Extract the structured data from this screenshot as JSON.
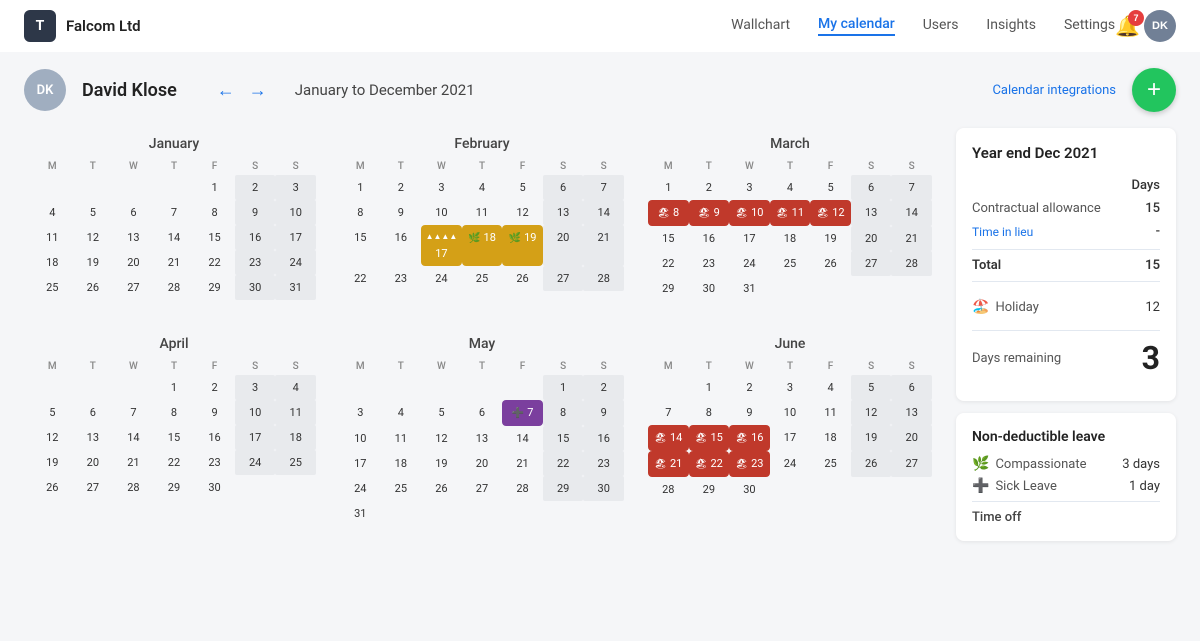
{
  "header": {
    "logo": "T",
    "company": "Falcom Ltd",
    "nav": [
      {
        "label": "Wallchart",
        "active": false
      },
      {
        "label": "My calendar",
        "active": true
      },
      {
        "label": "Users",
        "active": false
      },
      {
        "label": "Insights",
        "active": false
      },
      {
        "label": "Settings",
        "active": false
      }
    ],
    "notif_count": "7",
    "avatar": "DK"
  },
  "subheader": {
    "user_initials": "DK",
    "user_name": "David Klose",
    "date_range": "January to December 2021",
    "cal_integrations": "Calendar integrations",
    "add_btn": "+"
  },
  "calendars": [
    {
      "month": "January",
      "days_of_week": [
        "M",
        "T",
        "W",
        "T",
        "F",
        "S",
        "S"
      ],
      "weeks": [
        [
          null,
          null,
          null,
          null,
          1,
          2,
          3
        ],
        [
          4,
          5,
          6,
          7,
          8,
          9,
          10
        ],
        [
          11,
          12,
          13,
          14,
          15,
          16,
          17
        ],
        [
          18,
          19,
          20,
          21,
          22,
          23,
          24
        ],
        [
          25,
          26,
          27,
          28,
          29,
          30,
          31
        ]
      ],
      "special": {
        "2": "weekend",
        "3": "weekend",
        "9": "weekend",
        "10": "weekend",
        "16": "weekend",
        "17": "weekend",
        "23": "weekend",
        "24": "weekend",
        "30": "weekend",
        "31": "weekend"
      }
    },
    {
      "month": "February",
      "days_of_week": [
        "M",
        "T",
        "W",
        "T",
        "F",
        "S",
        "S"
      ],
      "weeks": [
        [
          1,
          2,
          3,
          4,
          5,
          6,
          7
        ],
        [
          8,
          9,
          10,
          11,
          12,
          13,
          14
        ],
        [
          15,
          16,
          17,
          18,
          19,
          20,
          21
        ],
        [
          22,
          23,
          24,
          25,
          26,
          27,
          28
        ]
      ],
      "special": {
        "6": "weekend",
        "7": "weekend",
        "13": "weekend",
        "14": "weekend",
        "17": "compassionate",
        "18": "compassionate",
        "19": "compassionate",
        "20": "weekend",
        "21": "weekend",
        "27": "weekend",
        "28": "weekend"
      }
    },
    {
      "month": "March",
      "days_of_week": [
        "M",
        "T",
        "W",
        "T",
        "F",
        "S",
        "S"
      ],
      "weeks": [
        [
          1,
          2,
          3,
          4,
          5,
          6,
          7
        ],
        [
          8,
          9,
          10,
          11,
          12,
          13,
          14
        ],
        [
          15,
          16,
          17,
          18,
          19,
          20,
          21
        ],
        [
          22,
          23,
          24,
          25,
          26,
          27,
          28
        ],
        [
          29,
          30,
          31,
          null,
          null,
          null,
          null
        ]
      ],
      "special": {
        "6": "weekend",
        "7": "weekend",
        "8": "holiday",
        "9": "holiday",
        "10": "holiday",
        "11": "holiday",
        "12": "holiday",
        "13": "weekend",
        "14": "weekend",
        "20": "weekend",
        "21": "weekend",
        "27": "weekend",
        "28": "weekend"
      }
    },
    {
      "month": "April",
      "days_of_week": [
        "M",
        "T",
        "W",
        "T",
        "F",
        "S",
        "S"
      ],
      "weeks": [
        [
          null,
          null,
          null,
          1,
          2,
          3,
          4
        ],
        [
          5,
          6,
          7,
          8,
          9,
          10,
          11
        ],
        [
          12,
          13,
          14,
          15,
          16,
          17,
          18
        ],
        [
          19,
          20,
          21,
          22,
          23,
          24,
          25
        ],
        [
          26,
          27,
          28,
          29,
          30,
          null,
          null
        ]
      ],
      "special": {
        "3": "weekend",
        "4": "weekend",
        "10": "weekend",
        "11": "weekend",
        "17": "weekend",
        "18": "weekend",
        "24": "weekend",
        "25": "weekend"
      }
    },
    {
      "month": "May",
      "days_of_week": [
        "M",
        "T",
        "W",
        "T",
        "F",
        "S",
        "S"
      ],
      "weeks": [
        [
          null,
          null,
          null,
          null,
          null,
          1,
          2
        ],
        [
          3,
          4,
          5,
          6,
          7,
          8,
          9
        ],
        [
          10,
          11,
          12,
          13,
          14,
          15,
          16
        ],
        [
          17,
          18,
          19,
          20,
          21,
          22,
          23
        ],
        [
          24,
          25,
          26,
          27,
          28,
          29,
          30
        ],
        [
          31,
          null,
          null,
          null,
          null,
          null,
          null
        ]
      ],
      "special": {
        "1": "weekend",
        "2": "weekend",
        "7": "sick",
        "8": "weekend",
        "9": "weekend",
        "15": "weekend",
        "16": "weekend",
        "22": "weekend",
        "23": "weekend",
        "29": "weekend",
        "30": "weekend"
      }
    },
    {
      "month": "June",
      "days_of_week": [
        "M",
        "T",
        "W",
        "T",
        "F",
        "S",
        "S"
      ],
      "weeks": [
        [
          null,
          1,
          2,
          3,
          4,
          5,
          6
        ],
        [
          7,
          8,
          9,
          10,
          11,
          12,
          13
        ],
        [
          14,
          15,
          16,
          17,
          18,
          19,
          20
        ],
        [
          21,
          22,
          23,
          24,
          25,
          26,
          27
        ],
        [
          28,
          29,
          30,
          null,
          null,
          null,
          null
        ]
      ],
      "special": {
        "5": "weekend",
        "6": "weekend",
        "12": "weekend",
        "13": "weekend",
        "14": "holiday",
        "15": "holiday",
        "16": "holiday",
        "19": "weekend",
        "20": "weekend",
        "21": "holiday",
        "22": "holiday",
        "23": "holiday",
        "26": "weekend",
        "27": "weekend"
      }
    }
  ],
  "sidebar": {
    "title": "Year end Dec 2021",
    "days_label": "Days",
    "contractual_allowance_label": "Contractual allowance",
    "contractual_allowance_value": "15",
    "time_in_lieu_label": "Time in lieu",
    "time_in_lieu_value": "-",
    "total_label": "Total",
    "total_value": "15",
    "holiday_label": "Holiday",
    "holiday_value": "12",
    "days_remaining_label": "Days remaining",
    "days_remaining_value": "3",
    "non_deductible_title": "Non-deductible leave",
    "compassionate_label": "Compassionate",
    "compassionate_value": "3 days",
    "sick_leave_label": "Sick Leave",
    "sick_leave_value": "1  day",
    "time_off_label": "Time off"
  }
}
